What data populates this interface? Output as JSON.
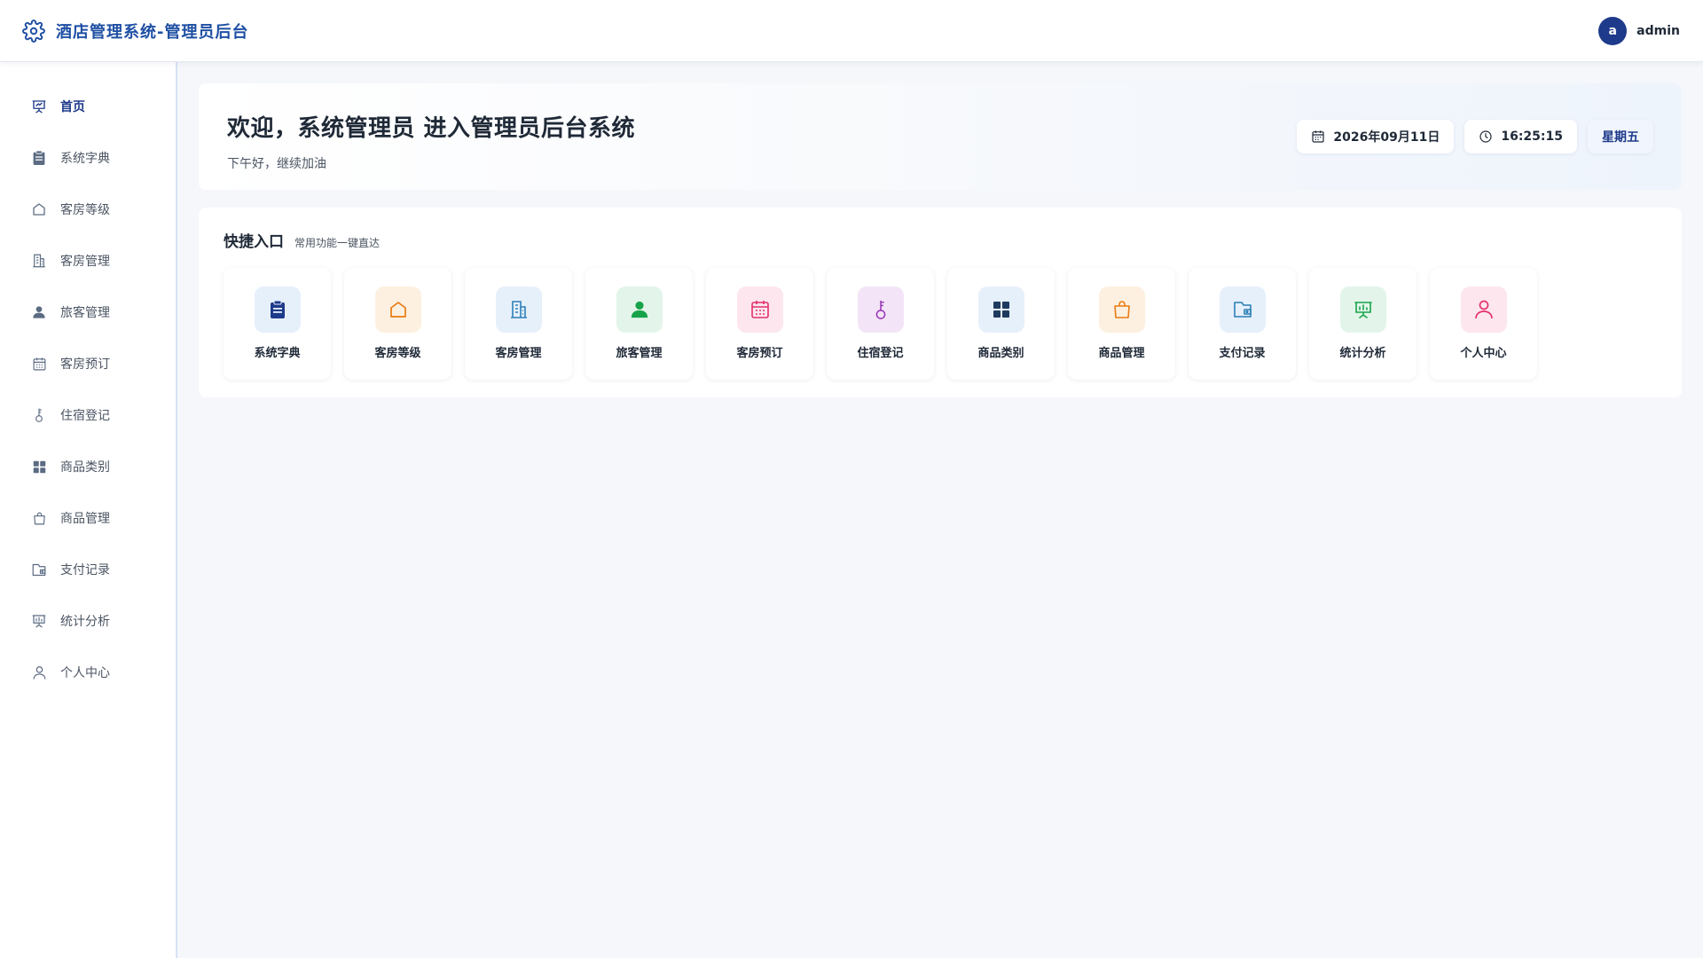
{
  "header": {
    "title": "酒店管理系统-管理员后台",
    "brand_icon": "gear-icon",
    "user": {
      "avatar_letter": "a",
      "name": "admin"
    }
  },
  "sidebar": {
    "items": [
      {
        "label": "首页",
        "icon": "presentation-board-icon",
        "active": true
      },
      {
        "label": "系统字典",
        "icon": "clipboard-icon"
      },
      {
        "label": "客房等级",
        "icon": "home-icon"
      },
      {
        "label": "客房管理",
        "icon": "building-icon"
      },
      {
        "label": "旅客管理",
        "icon": "user-icon"
      },
      {
        "label": "客房预订",
        "icon": "calendar-icon"
      },
      {
        "label": "住宿登记",
        "icon": "key-icon"
      },
      {
        "label": "商品类别",
        "icon": "grid-icon"
      },
      {
        "label": "商品管理",
        "icon": "shopping-bag-icon"
      },
      {
        "label": "支付记录",
        "icon": "wallet-icon"
      },
      {
        "label": "统计分析",
        "icon": "chart-board-icon"
      },
      {
        "label": "个人中心",
        "icon": "user-outline-icon"
      }
    ]
  },
  "welcome": {
    "title": "欢迎，系统管理员 进入管理员后台系统",
    "subtitle": "下午好，继续加油",
    "date": "2026年09月11日",
    "time": "16:25:15",
    "weekday": "星期五"
  },
  "quick": {
    "title": "快捷入口",
    "subtitle": "常用功能一键直达",
    "tiles": [
      {
        "label": "系统字典",
        "icon": "clipboard-icon",
        "color": "#1e3a8a",
        "bg": "#e6f0fb"
      },
      {
        "label": "客房等级",
        "icon": "home-icon",
        "color": "#ea7a12",
        "bg": "#fdf0e0"
      },
      {
        "label": "客房管理",
        "icon": "building-icon",
        "color": "#2c7fb8",
        "bg": "#e6f0fb"
      },
      {
        "label": "旅客管理",
        "icon": "user-icon",
        "color": "#17a34a",
        "bg": "#e3f5ea"
      },
      {
        "label": "客房预订",
        "icon": "calendar-icon",
        "color": "#e3306e",
        "bg": "#fde6ee"
      },
      {
        "label": "住宿登记",
        "icon": "key-icon",
        "color": "#9a37b8",
        "bg": "#f3e5f7"
      },
      {
        "label": "商品类别",
        "icon": "grid-icon",
        "color": "#1e3a5f",
        "bg": "#e6f0fb"
      },
      {
        "label": "商品管理",
        "icon": "shopping-bag-icon",
        "color": "#ea7a12",
        "bg": "#fdf0e0"
      },
      {
        "label": "支付记录",
        "icon": "wallet-icon",
        "color": "#2c7fb8",
        "bg": "#e6f0fb"
      },
      {
        "label": "统计分析",
        "icon": "chart-board-icon",
        "color": "#17a34a",
        "bg": "#e3f5ea"
      },
      {
        "label": "个人中心",
        "icon": "user-outline-icon",
        "color": "#e3306e",
        "bg": "#fde6ee"
      }
    ]
  },
  "colors": {
    "brand": "#1e4fa3",
    "active_nav": "#1e3a8a",
    "sidebar_icon": "#5b6b82"
  }
}
